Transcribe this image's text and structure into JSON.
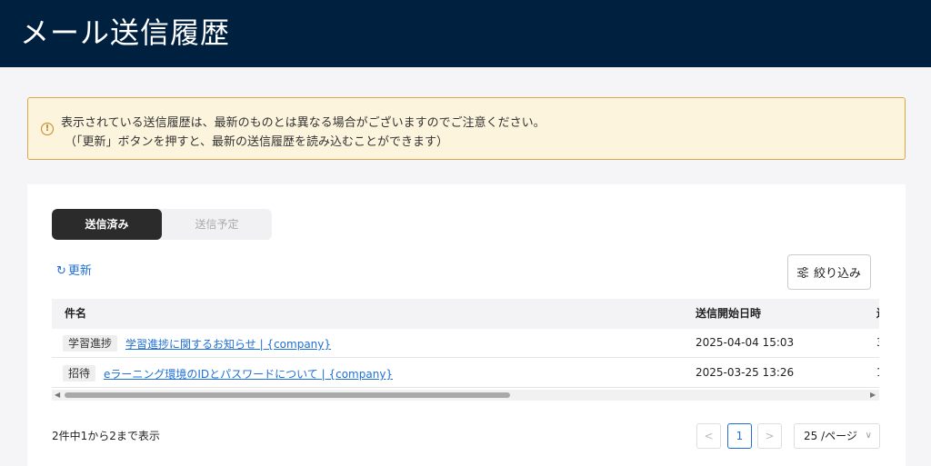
{
  "header": {
    "title": "メール送信履歴"
  },
  "alert": {
    "icon": "warning-icon",
    "line1": "表示されている送信履歴は、最新のものとは異なる場合がございますのでご注意ください。",
    "line2": "（「更新」ボタンを押すと、最新の送信履歴を読み込むことができます）"
  },
  "tabs": [
    {
      "label": "送信済み",
      "active": true
    },
    {
      "label": "送信予定",
      "active": false
    }
  ],
  "toolbar": {
    "refresh_label": "更新",
    "filter_label": "絞り込み"
  },
  "table": {
    "columns": [
      "件名",
      "送信開始日時",
      "送"
    ],
    "rows": [
      {
        "tag": "学習進捗",
        "subject": "学習進捗に関するお知らせ | {company}",
        "date": "2025-04-04 15:03",
        "extra": "3"
      },
      {
        "tag": "招待",
        "subject": "eラーニング環境のIDとパスワードについて | {company}",
        "date": "2025-03-25 13:26",
        "extra": "1"
      }
    ]
  },
  "pagination": {
    "summary": "2件中1から2まで表示",
    "prev": "<",
    "current_page": "1",
    "next": ">",
    "page_size": "25 /ページ"
  },
  "colors": {
    "header_bg": "#00203f",
    "link": "#1f6fd6",
    "alert_bg": "#fdf4de"
  }
}
